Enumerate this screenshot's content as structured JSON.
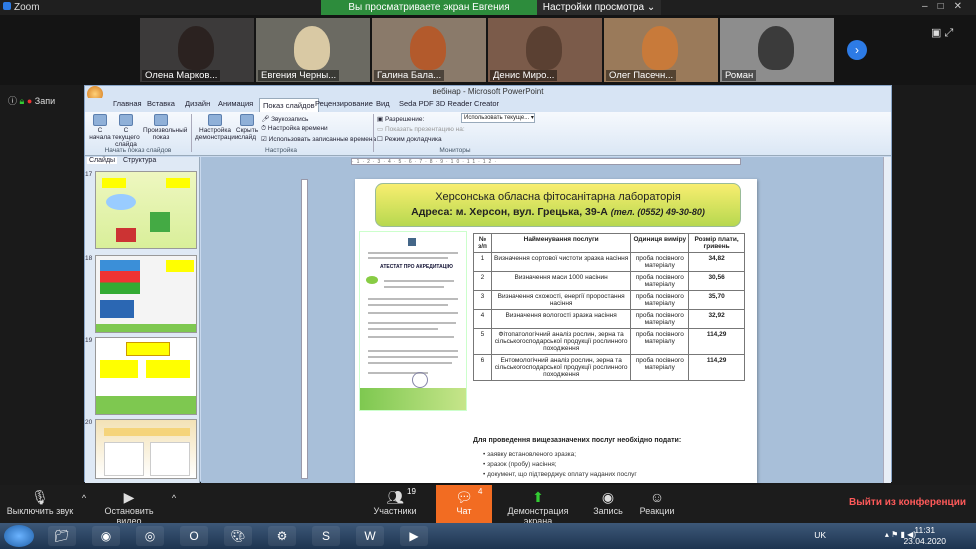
{
  "zoom": {
    "app_title": "Zoom",
    "viewing_banner": "Вы просматриваете экран Евгения Чернышова",
    "view_settings": "Настройки просмотра ⌄",
    "recording_label": "Запи",
    "participants": [
      {
        "name": "Олена Марков..."
      },
      {
        "name": "Евгения Черны..."
      },
      {
        "name": "Галина Бала..."
      },
      {
        "name": "Денис Миро..."
      },
      {
        "name": "Олег Пасечн..."
      },
      {
        "name": "Роман"
      }
    ],
    "toolbar": {
      "mute": "Выключить звук",
      "video": "Остановить видео",
      "participants": "Участники",
      "participants_count": "19",
      "chat": "Чат",
      "chat_count": "4",
      "share": "Демонстрация экрана",
      "record": "Запись",
      "reactions": "Реакции",
      "leave": "Выйти из конференции"
    }
  },
  "ppt": {
    "window_title": "вебінар - Microsoft PowerPoint",
    "tabs": [
      "Главная",
      "Вставка",
      "Дизайн",
      "Анимация",
      "Показ слайдов",
      "Рецензирование",
      "Вид",
      "Seda PDF 3D Reader Creator"
    ],
    "active_tab_index": 4,
    "ribbon": {
      "btn_from_start": "С начала",
      "btn_from_current": "С текущего слайда",
      "btn_custom": "Произвольный показ",
      "group_start": "Начать показ слайдов",
      "btn_setup": "Настройка демонстрации",
      "btn_hide": "Скрыть слайд",
      "line_record": "Звукозапись",
      "line_timing": "Настройка времени",
      "line_use_timing": "Использовать записанные времена",
      "group_setup": "Настройка",
      "line_resolution": "Разрешение:",
      "resolution_value": "Использовать текуще...",
      "line_show_on": "Показать презентацию на:",
      "line_presenter": "Режим докладчика",
      "group_monitors": "Мониторы"
    },
    "panel_tabs": [
      "Слайды",
      "Структура"
    ],
    "thumb_numbers": [
      "17",
      "18",
      "19",
      "20"
    ],
    "slide": {
      "header_line1": "Херсонська обласна фітосанітарна  лабораторія",
      "header_line2_bold": "Адреса: м. Херсон, вул. Грецька, 39-А",
      "header_line2_phone": "(тел. (0552) 49-30-80)",
      "cert_title": "АТЕСТАТ ПРО АКРЕДИТАЦІЮ",
      "table": {
        "headers": [
          "№ з/п",
          "Найменування послуги",
          "Одиниця виміру",
          "Розмір плати, гривень"
        ],
        "rows": [
          {
            "n": "1",
            "service": "Визначення сортової чистоти зразка насіння",
            "unit": "проба посівного матеріалу",
            "price": "34,82"
          },
          {
            "n": "2",
            "service": "Визначення маси 1000 насінин",
            "unit": "проба посівного матеріалу",
            "price": "30,56"
          },
          {
            "n": "3",
            "service": "Визначення схожості, енергії проростання насіння",
            "unit": "проба посівного матеріалу",
            "price": "35,70"
          },
          {
            "n": "4",
            "service": "Визначення вологості зразка насіння",
            "unit": "проба посівного матеріалу",
            "price": "32,92"
          },
          {
            "n": "5",
            "service": "Фітопатологічний аналіз рослин, зерна та сільськогосподарської продукції рослинного походження",
            "unit": "проба посівного матеріалу",
            "price": "114,29"
          },
          {
            "n": "6",
            "service": "Ентомологічний аналіз рослин, зерна та сільськогосподарської продукції рослинного походження",
            "unit": "проба посівного матеріалу",
            "price": "114,29"
          }
        ]
      },
      "notes_title": "Для проведення вищезазначених послуг необхідно подати:",
      "bullets": [
        "заявку встановленого зразка;",
        "зразок (пробу) насіння;",
        "документ, що підтверджує оплату наданих послуг"
      ]
    }
  },
  "taskbar": {
    "lang": "UK",
    "time": "11:31",
    "date": "23.04.2020"
  },
  "colors": {
    "banner_green": "#2d8c3c",
    "chat_orange": "#f26c22",
    "leave_red": "#ff5a5a",
    "header_yellow": "#f8ee70"
  }
}
